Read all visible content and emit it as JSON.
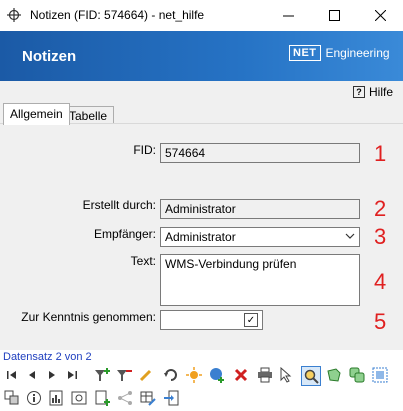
{
  "window": {
    "title": "Notizen (FID: 574664) - net_hilfe",
    "minimize": "—",
    "close": "✕"
  },
  "banner": {
    "heading": "Notizen",
    "logo_box": "NET",
    "logo_text": "Engineering"
  },
  "help": {
    "label": "Hilfe",
    "icon": "?"
  },
  "tabs": [
    {
      "label": "Allgemein"
    },
    {
      "label": "Tabelle"
    }
  ],
  "form": {
    "fid": {
      "label": "FID:",
      "value": "574664",
      "num": "1"
    },
    "created_by": {
      "label": "Erstellt durch:",
      "value": "Administrator",
      "num": "2"
    },
    "recipient": {
      "label": "Empfänger:",
      "value": "Administrator",
      "num": "3"
    },
    "text": {
      "label": "Text:",
      "value": "WMS-Verbindung prüfen",
      "num": "4"
    },
    "acknowledged": {
      "label": "Zur Kenntnis genommen:",
      "check": "✓",
      "num": "5"
    }
  },
  "status": "Datensatz 2 von 2"
}
